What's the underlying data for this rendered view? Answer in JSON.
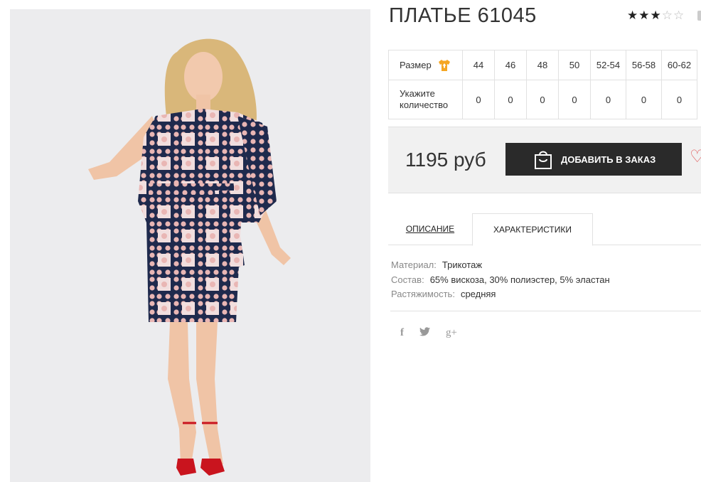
{
  "product": {
    "title": "ПЛАТЬЕ 61045",
    "rating": {
      "value": 3,
      "max": 5
    }
  },
  "sizes_table": {
    "size_label": "Размер",
    "quantity_label": "Укажите количество",
    "sizes": [
      "44",
      "46",
      "48",
      "50",
      "52-54",
      "56-58",
      "60-62"
    ],
    "quantities": [
      "0",
      "0",
      "0",
      "0",
      "0",
      "0",
      "0"
    ]
  },
  "price_block": {
    "price": "1195 руб",
    "add_button_label": "ДОБАВИТЬ В ЗАКАЗ"
  },
  "tabs": [
    {
      "label": "ОПИСАНИЕ",
      "active": false
    },
    {
      "label": "ХАРАКТЕРИСТИКИ",
      "active": true
    }
  ],
  "specs": [
    {
      "key": "Материал:",
      "value": "Трикотаж"
    },
    {
      "key": "Состав:",
      "value": "65% вискоза, 30% полиэстер, 5% эластан"
    },
    {
      "key": "Растяжимость:",
      "value": "средняя"
    }
  ],
  "social": [
    {
      "icon": "facebook-icon",
      "glyph": "f"
    },
    {
      "icon": "twitter-icon",
      "glyph": "t"
    },
    {
      "icon": "google-plus-icon",
      "glyph": "g+"
    }
  ],
  "colors": {
    "button_bg": "#2a2a2a",
    "price_bg": "#f1f1f1",
    "size_icon": "#f5a623",
    "heart": "#e05a5a",
    "dress_navy": "#1f2a4d",
    "dress_pink": "#e9b6b4",
    "shoes_red": "#c9141e"
  }
}
